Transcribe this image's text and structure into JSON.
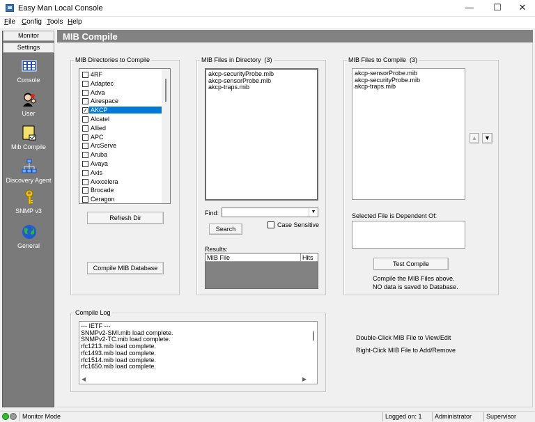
{
  "window": {
    "title": "Easy Man Local Console",
    "controls": {
      "minimize": "—",
      "maximize": "☐",
      "close": "✕"
    }
  },
  "menu": {
    "file": {
      "accel": "F",
      "rest": "ile"
    },
    "config": {
      "accel": "C",
      "rest": "onfig"
    },
    "tools": {
      "accel": "T",
      "rest": "ools"
    },
    "help": {
      "accel": "H",
      "rest": "elp"
    }
  },
  "nav": {
    "tabs": [
      "Monitor",
      "Settings"
    ],
    "items": [
      {
        "label": "Console",
        "icon": "console-icon"
      },
      {
        "label": "User",
        "icon": "user-icon"
      },
      {
        "label": "Mib Compile",
        "icon": "mib-compile-icon"
      },
      {
        "label": "Discovery Agent",
        "icon": "discovery-agent-icon"
      },
      {
        "label": "SNMP v3",
        "icon": "key-icon"
      },
      {
        "label": "General",
        "icon": "globe-icon"
      }
    ]
  },
  "page": {
    "title": "MIB Compile"
  },
  "dirs": {
    "label": "MIB Directories to Compile",
    "items": [
      {
        "name": "4RF",
        "checked": false
      },
      {
        "name": "Adaptec",
        "checked": false
      },
      {
        "name": "Adva",
        "checked": false
      },
      {
        "name": "Airespace",
        "checked": false
      },
      {
        "name": "AKCP",
        "checked": true,
        "selected": true
      },
      {
        "name": "Alcatel",
        "checked": false
      },
      {
        "name": "Allied",
        "checked": false
      },
      {
        "name": "APC",
        "checked": false
      },
      {
        "name": "ArcServe",
        "checked": false
      },
      {
        "name": "Aruba",
        "checked": false
      },
      {
        "name": "Avaya",
        "checked": false
      },
      {
        "name": "Axis",
        "checked": false
      },
      {
        "name": "Axxcelera",
        "checked": false
      },
      {
        "name": "Brocade",
        "checked": false
      },
      {
        "name": "Ceragon",
        "checked": false
      }
    ],
    "refresh_btn": "Refresh Dir",
    "compile_db_btn": "Compile MIB Database"
  },
  "files_in_dir": {
    "label": "MIB Files in Directory",
    "count": "(3)",
    "items": [
      "akcp-securityProbe.mib",
      "akcp-sensorProbe.mib",
      "akcp-traps.mib"
    ],
    "find_label": "Find:",
    "find_value": "",
    "search_btn": "Search",
    "case_label": "Case Sensitive",
    "case_checked": false,
    "results_label": "Results:",
    "results_columns": [
      "MIB File",
      "Hits"
    ]
  },
  "files_to_compile": {
    "label": "MIB Files to Compile",
    "count": "(3)",
    "items": [
      "akcp-sensorProbe.mib",
      "akcp-securityProbe.mib",
      "akcp-traps.mib"
    ],
    "up_icon": "arrow-up-icon",
    "down_icon": "arrow-down-icon",
    "dependent_label": "Selected File is Dependent Of:",
    "test_btn": "Test Compile",
    "note_line1": "Compile the MIB Files above.",
    "note_line2": "NO data is saved to Database."
  },
  "log": {
    "label": "Compile Log",
    "lines": [
      "--- IETF ---",
      "SNMPv2-SMI.mib load complete.",
      "SNMPv2-TC.mib load complete.",
      "rfc1213.mib load complete.",
      "rfc1493.mib load complete.",
      "rfc1514.mib load complete.",
      "rfc1650.mib load complete."
    ]
  },
  "hints": {
    "line1": "Double-Click MIB File to View/Edit",
    "line2": "Right-Click MIB File to Add/Remove"
  },
  "status": {
    "mode": "Monitor Mode",
    "logged_on": "Logged on: 1",
    "role1": "Administrator",
    "role2": "Supervisor"
  },
  "colors": {
    "nav_bg": "#7a7a7a",
    "header_bg": "#828282",
    "selection": "#0078d7",
    "led_green": "#2fbf2f",
    "led_gray": "#9a9a9a"
  }
}
